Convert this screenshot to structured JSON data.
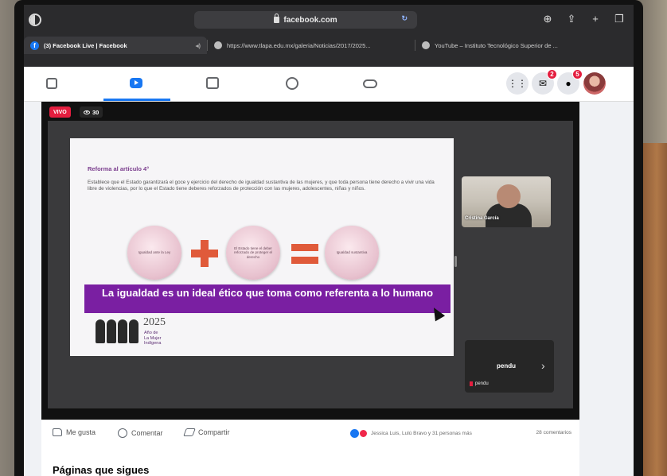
{
  "browser": {
    "url": "facebook.com",
    "tabs": [
      {
        "label": "(3) Facebook Live | Facebook",
        "active": true
      },
      {
        "label": "https://www.tlapa.edu.mx/galeria/Noticias/2017/2025...",
        "active": false
      },
      {
        "label": "YouTube – Instituto Tecnológico Superior de ...",
        "active": false
      }
    ]
  },
  "nav": {
    "messenger_badge": "2",
    "notifications_badge": "5"
  },
  "video": {
    "live_label": "VIVO",
    "viewers": "30"
  },
  "slide": {
    "heading": "Reforma al artículo 4°",
    "body": "Establece que el Estado garantizará el goce y ejercicio del derecho de igualdad sustantiva de las mujeres, y que toda persona tiene derecho a vivir una vida libre de violencias, por lo que el Estado tiene deberes reforzados de protección con las mujeres, adolescentes, niñas y niños.",
    "circle_1": "Igualdad ante la Ley",
    "circle_2": "El Estado tiene el deber reforzado de proteger el derecho",
    "circle_3": "Igualdad sustantiva",
    "banner": "La igualdad es un ideal ético que toma como referenta a lo humano",
    "logo_year": "2025",
    "logo_line_1": "Año de",
    "logo_line_2": "La Mujer",
    "logo_line_3": "Indígena"
  },
  "participants": {
    "camera_name": "Cristina García",
    "pending_label": "pendu",
    "pending_mini_label": "pendu"
  },
  "actions": {
    "like": "Me gusta",
    "comment": "Comentar",
    "share": "Compartir",
    "reactions_text": "Jessica Luis, Lulú Bravo y 31 personas más",
    "comments_count": "28 comentarios"
  },
  "section": {
    "pages_title": "Páginas que sigues"
  },
  "colors": {
    "fb_blue": "#1877f2",
    "live_red": "#e41e3f",
    "banner_purple": "#7a1fa2",
    "symbol_orange": "#e05a3a"
  }
}
